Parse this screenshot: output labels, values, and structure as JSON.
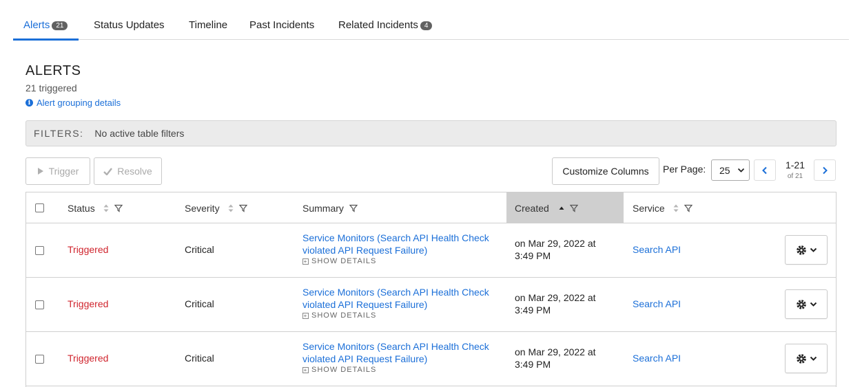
{
  "tabs": [
    {
      "label": "Alerts",
      "badge": "21",
      "active": true
    },
    {
      "label": "Status Updates"
    },
    {
      "label": "Timeline"
    },
    {
      "label": "Past Incidents"
    },
    {
      "label": "Related Incidents",
      "badge": "4"
    }
  ],
  "header": {
    "title": "ALERTS",
    "subtitle": "21 triggered",
    "grouping_link": "Alert grouping details"
  },
  "filters": {
    "label": "FILTERS:",
    "value": "No active table filters"
  },
  "toolbar": {
    "trigger_label": "Trigger",
    "resolve_label": "Resolve",
    "customize_label": "Customize Columns",
    "per_page_label": "Per Page:",
    "per_page_value": "25",
    "range": "1-21",
    "of_total": "of 21"
  },
  "columns": {
    "status": "Status",
    "severity": "Severity",
    "summary": "Summary",
    "created": "Created",
    "service": "Service"
  },
  "rows": [
    {
      "status": "Triggered",
      "severity": "Critical",
      "summary": "Service Monitors (Search API Health Check violated API Request Failure)",
      "show_details": "SHOW DETAILS",
      "created": "on Mar 29, 2022 at 3:49 PM",
      "service": "Search API"
    },
    {
      "status": "Triggered",
      "severity": "Critical",
      "summary": "Service Monitors (Search API Health Check violated API Request Failure)",
      "show_details": "SHOW DETAILS",
      "created": "on Mar 29, 2022 at 3:49 PM",
      "service": "Search API"
    },
    {
      "status": "Triggered",
      "severity": "Critical",
      "summary": "Service Monitors (Search API Health Check violated API Request Failure)",
      "show_details": "SHOW DETAILS",
      "created": "on Mar 29, 2022 at 3:49 PM",
      "service": "Search API"
    }
  ],
  "colors": {
    "accent": "#1b6fd8",
    "triggered": "#d0242d",
    "badge": "#616161",
    "sorted_header": "#cfcfcf"
  }
}
